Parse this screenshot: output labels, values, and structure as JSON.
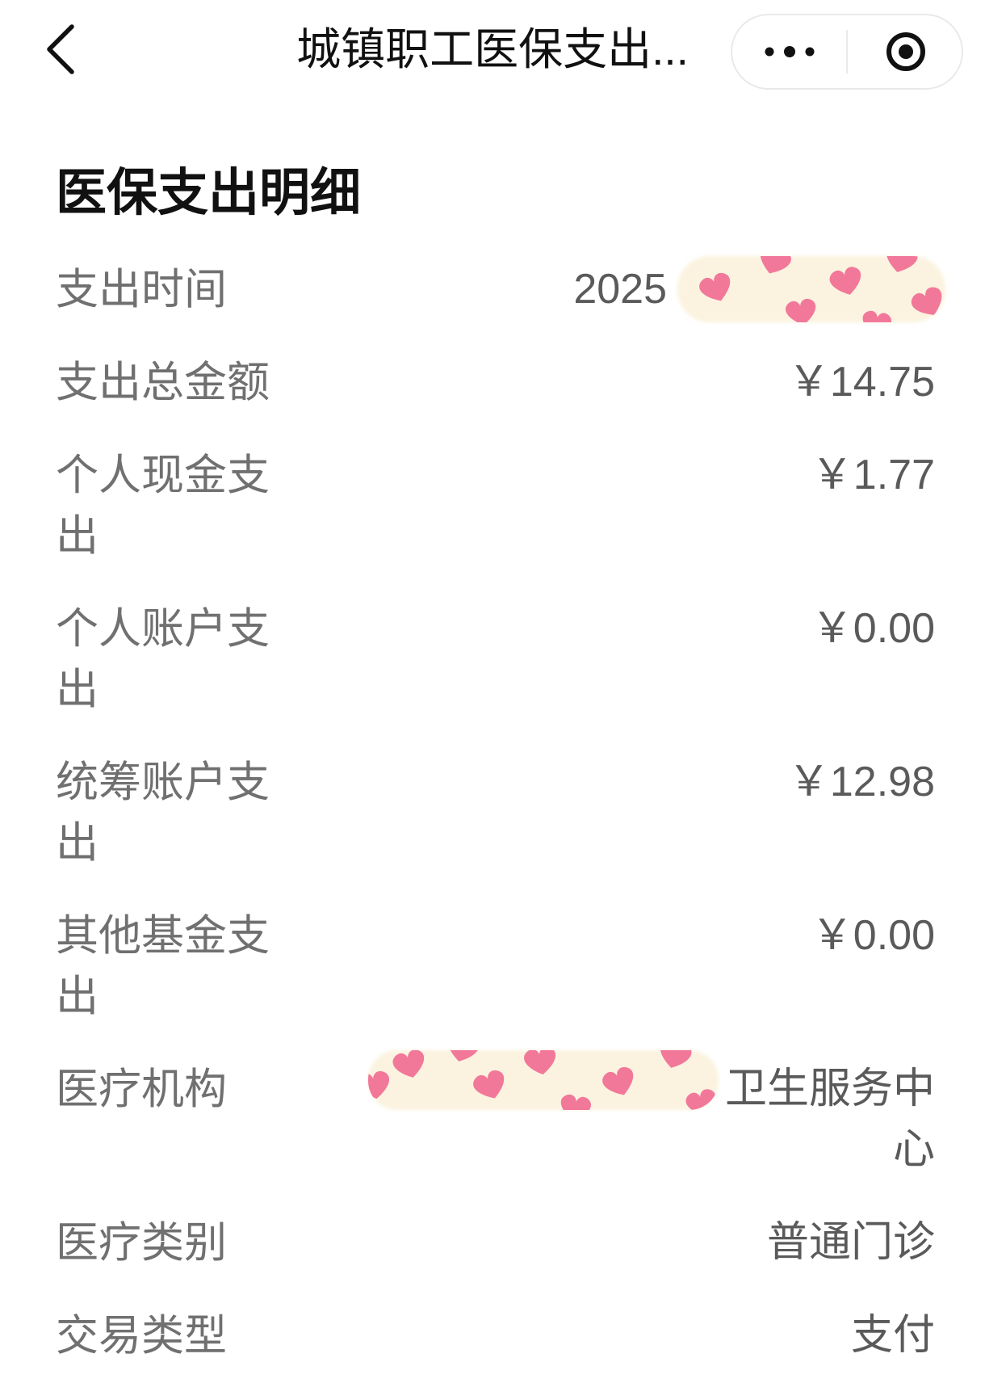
{
  "nav": {
    "title": "城镇职工医保支出...",
    "back_icon": "chevron-left-icon",
    "more_icon": "more-dots-icon",
    "capsule_close_icon": "target-circle-icon"
  },
  "heading": "医保支出明细",
  "details": [
    {
      "label": "支出时间",
      "value": "2025"
    },
    {
      "label": "支出总金额",
      "value": "￥14.75"
    },
    {
      "label": "个人现金支出",
      "value": "￥1.77"
    },
    {
      "label": "个人账户支出",
      "value": "￥0.00"
    },
    {
      "label": "统筹账户支出",
      "value": "￥12.98"
    },
    {
      "label": "其他基金支出",
      "value": "￥0.00"
    },
    {
      "label": "医疗机构",
      "value": "卫生服务中心"
    },
    {
      "label": "医疗类别",
      "value": "普通门诊"
    },
    {
      "label": "交易类型",
      "value": "支付"
    }
  ],
  "colors": {
    "background": "#ffffff",
    "heading": "#111111",
    "label": "#707070",
    "value": "#5a5a5a",
    "icon": "#111111",
    "capsule_border": "#e9e9e9",
    "sticker_base": "#fbf3df",
    "sticker_heart": "#f2789a"
  }
}
